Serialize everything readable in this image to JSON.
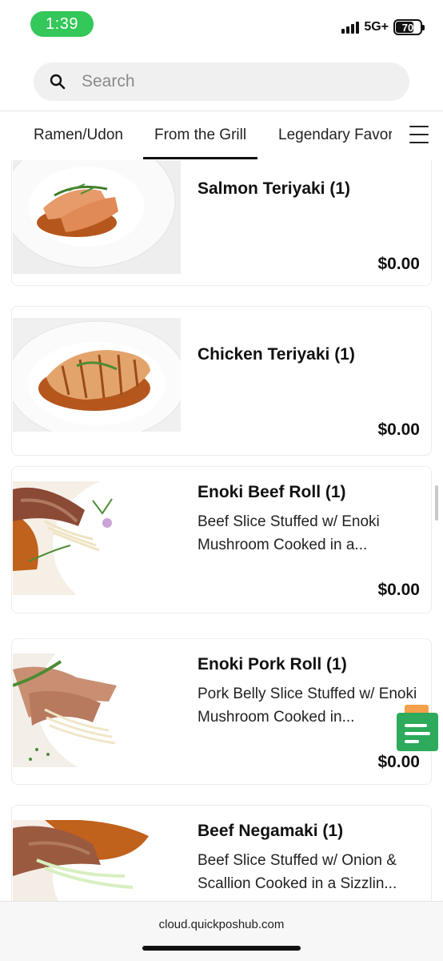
{
  "status_bar": {
    "time": "1:39",
    "network": "5G+",
    "battery": "70"
  },
  "search": {
    "placeholder": "Search"
  },
  "tabs": [
    {
      "label": "Ramen/Udon",
      "active": false
    },
    {
      "label": "From the Grill",
      "active": true
    },
    {
      "label": "Legendary Favorites",
      "active": false
    }
  ],
  "items": [
    {
      "name": "Salmon Teriyaki (1)",
      "description": "",
      "price": "$0.00"
    },
    {
      "name": "Chicken Teriyaki (1)",
      "description": "",
      "price": "$0.00"
    },
    {
      "name": "Enoki Beef Roll (1)",
      "description": "Beef Slice Stuffed w/ Enoki Mushroom Cooked in a...",
      "price": "$0.00"
    },
    {
      "name": "Enoki Pork Roll (1)",
      "description": "Pork Belly Slice Stuffed w/ Enoki Mushroom Cooked in...",
      "price": "$0.00"
    },
    {
      "name": "Beef Negamaki (1)",
      "description": "Beef Slice Stuffed w/ Onion & Scallion Cooked in a Sizzlin...",
      "price": ""
    }
  ],
  "browser": {
    "url": "cloud.quickposhub.com"
  },
  "colors": {
    "time_pill": "#34c759",
    "fab_green": "#2eaa5c",
    "fab_orange": "#f5a04a",
    "sauce": "#b5571c"
  }
}
